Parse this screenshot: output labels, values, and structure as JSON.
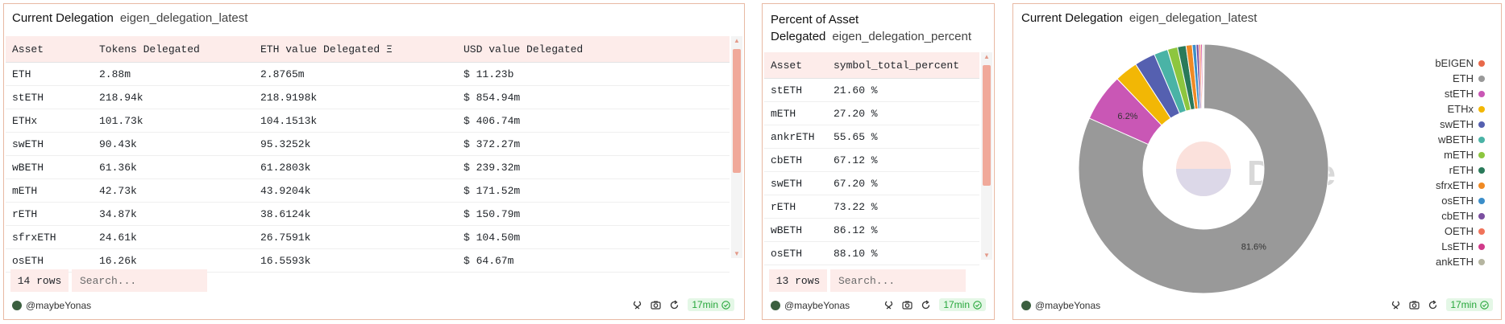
{
  "panel1": {
    "title": "Current Delegation",
    "subtitle": "eigen_delegation_latest",
    "columns": [
      "Asset",
      "Tokens Delegated",
      "ETH value Delegated Ξ",
      "USD value Delegated"
    ],
    "rows": [
      [
        "ETH",
        "2.88m",
        "2.8765m",
        "$ 11.23b"
      ],
      [
        "stETH",
        "218.94k",
        "218.9198k",
        "$ 854.94m"
      ],
      [
        "ETHx",
        "101.73k",
        "104.1513k",
        "$ 406.74m"
      ],
      [
        "swETH",
        "90.43k",
        "95.3252k",
        "$ 372.27m"
      ],
      [
        "wBETH",
        "61.36k",
        "61.2803k",
        "$ 239.32m"
      ],
      [
        "mETH",
        "42.73k",
        "43.9204k",
        "$ 171.52m"
      ],
      [
        "rETH",
        "34.87k",
        "38.6124k",
        "$ 150.79m"
      ],
      [
        "sfrxETH",
        "24.61k",
        "26.7591k",
        "$ 104.50m"
      ],
      [
        "osETH",
        "16.26k",
        "16.5593k",
        "$ 64.67m"
      ]
    ],
    "row_count": "14 rows",
    "search_placeholder": "Search...",
    "author": "@maybeYonas",
    "age": "17min"
  },
  "panel2": {
    "title_line1": "Percent of Asset",
    "title_line2": "Delegated",
    "subtitle": "eigen_delegation_percent",
    "columns": [
      "Asset",
      "symbol_total_percent"
    ],
    "rows": [
      [
        "stETH",
        "21.60 %"
      ],
      [
        "mETH",
        "27.20 %"
      ],
      [
        "ankrETH",
        "55.65 %"
      ],
      [
        "cbETH",
        "67.12 %"
      ],
      [
        "swETH",
        "67.20 %"
      ],
      [
        "rETH",
        "73.22 %"
      ],
      [
        "wBETH",
        "86.12 %"
      ],
      [
        "osETH",
        "88.10 %"
      ]
    ],
    "row_count": "13 rows",
    "search_placeholder": "Search...",
    "author": "@maybeYonas",
    "age": "17min"
  },
  "panel3": {
    "title": "Current Delegation",
    "subtitle": "eigen_delegation_latest",
    "watermark": "Dune",
    "author": "@maybeYonas",
    "age": "17min"
  },
  "chart_data": {
    "type": "pie",
    "style": "donut",
    "legend_position": "right",
    "slices": [
      {
        "label": "bEIGEN",
        "value": 0.1,
        "color": "#e8694a"
      },
      {
        "label": "ETH",
        "value": 81.6,
        "color": "#999999",
        "data_label": "81.6%"
      },
      {
        "label": "stETH",
        "value": 6.2,
        "color": "#c957b5",
        "data_label": "6.2%"
      },
      {
        "label": "ETHx",
        "value": 3.0,
        "color": "#f2b705"
      },
      {
        "label": "swETH",
        "value": 2.7,
        "color": "#5560b0"
      },
      {
        "label": "wBETH",
        "value": 1.8,
        "color": "#4ab3a6"
      },
      {
        "label": "mETH",
        "value": 1.3,
        "color": "#8dc63f"
      },
      {
        "label": "rETH",
        "value": 1.1,
        "color": "#2a7a5a"
      },
      {
        "label": "sfrxETH",
        "value": 0.8,
        "color": "#f08a24"
      },
      {
        "label": "osETH",
        "value": 0.5,
        "color": "#3b8ec9"
      },
      {
        "label": "cbETH",
        "value": 0.35,
        "color": "#7b4fa0"
      },
      {
        "label": "OETH",
        "value": 0.25,
        "color": "#f0735a"
      },
      {
        "label": "LsETH",
        "value": 0.2,
        "color": "#d13b8a"
      },
      {
        "label": "ankETH",
        "value": 0.15,
        "color": "#b5b5a0"
      }
    ]
  }
}
